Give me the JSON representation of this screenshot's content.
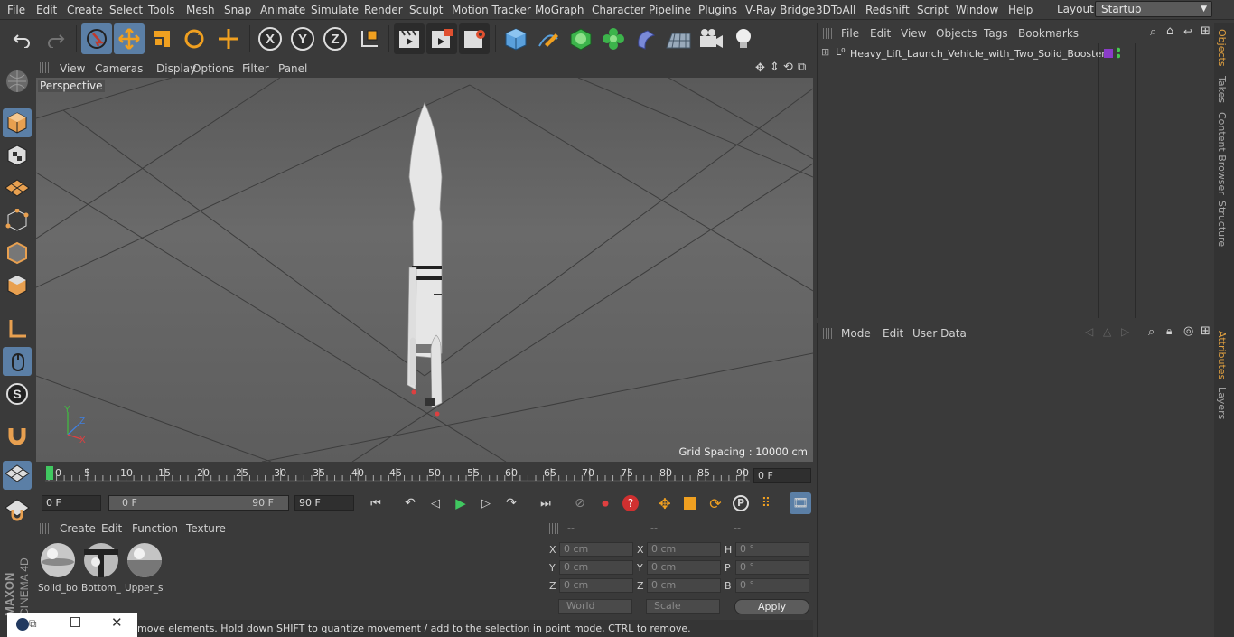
{
  "menubar": {
    "items": [
      "File",
      "Edit",
      "Create",
      "Select",
      "Tools",
      "Mesh",
      "Snap",
      "Animate",
      "Simulate",
      "Render",
      "Sculpt",
      "Motion Tracker",
      "MoGraph",
      "Character",
      "Pipeline",
      "Plugins",
      "V-Ray Bridge",
      "3DToAll",
      "Redshift",
      "Script",
      "Window",
      "Help"
    ],
    "layout_label": "Layout:",
    "layout_value": "Startup"
  },
  "viewport": {
    "menu": [
      "View",
      "Cameras",
      "Display",
      "Options",
      "Filter",
      "Panel"
    ],
    "camera_label": "Perspective",
    "grid_spacing": "Grid Spacing : 10000 cm",
    "axis_labels": {
      "y": "Y",
      "z": "Z",
      "x": "X"
    }
  },
  "timeline": {
    "ticks": [
      "0",
      "5",
      "10",
      "15",
      "20",
      "25",
      "30",
      "35",
      "40",
      "45",
      "50",
      "55",
      "60",
      "65",
      "70",
      "75",
      "80",
      "85",
      "90"
    ],
    "current_frame": "0 F"
  },
  "transport": {
    "start_field": "0 F",
    "range_start": "0 F",
    "range_end": "90 F",
    "end_field": "90 F"
  },
  "materials": {
    "menu": [
      "Create",
      "Edit",
      "Function",
      "Texture"
    ],
    "items": [
      {
        "label": "Solid_bo"
      },
      {
        "label": "Bottom_"
      },
      {
        "label": "Upper_s"
      }
    ]
  },
  "coordinates": {
    "headers": [
      "--",
      "--",
      "--"
    ],
    "rows": [
      {
        "a": "X",
        "a_val": "0 cm",
        "b": "X",
        "b_val": "0 cm",
        "c": "H",
        "c_val": "0 °"
      },
      {
        "a": "Y",
        "a_val": "0 cm",
        "b": "Y",
        "b_val": "0 cm",
        "c": "P",
        "c_val": "0 °"
      },
      {
        "a": "Z",
        "a_val": "0 cm",
        "b": "Z",
        "b_val": "0 cm",
        "c": "B",
        "c_val": "0 °"
      }
    ],
    "world": "World",
    "scale": "Scale",
    "apply": "Apply"
  },
  "status": {
    "text": "move elements. Hold down SHIFT to quantize movement / add to the selection in point mode, CTRL to remove."
  },
  "objects": {
    "menu": [
      "File",
      "Edit",
      "View",
      "Objects",
      "Tags",
      "Bookmarks"
    ],
    "tree": [
      {
        "name": "Heavy_Lift_Launch_Vehicle_with_Two_Solid_Boosters",
        "tag_color": "#8a3cc8",
        "layer_color": "#46c850"
      }
    ]
  },
  "attributes": {
    "menu": [
      "Mode",
      "Edit",
      "User Data"
    ]
  },
  "right_tabs": {
    "top": [
      "Objects",
      "Takes",
      "Content Browser",
      "Structure"
    ],
    "bottom": [
      "Attributes",
      "Layers"
    ]
  },
  "brand": {
    "maxon": "MAXON",
    "product": "CINEMA 4D"
  },
  "colors": {
    "accent": "#5b7fa6",
    "tab_active": "#e0a040"
  }
}
